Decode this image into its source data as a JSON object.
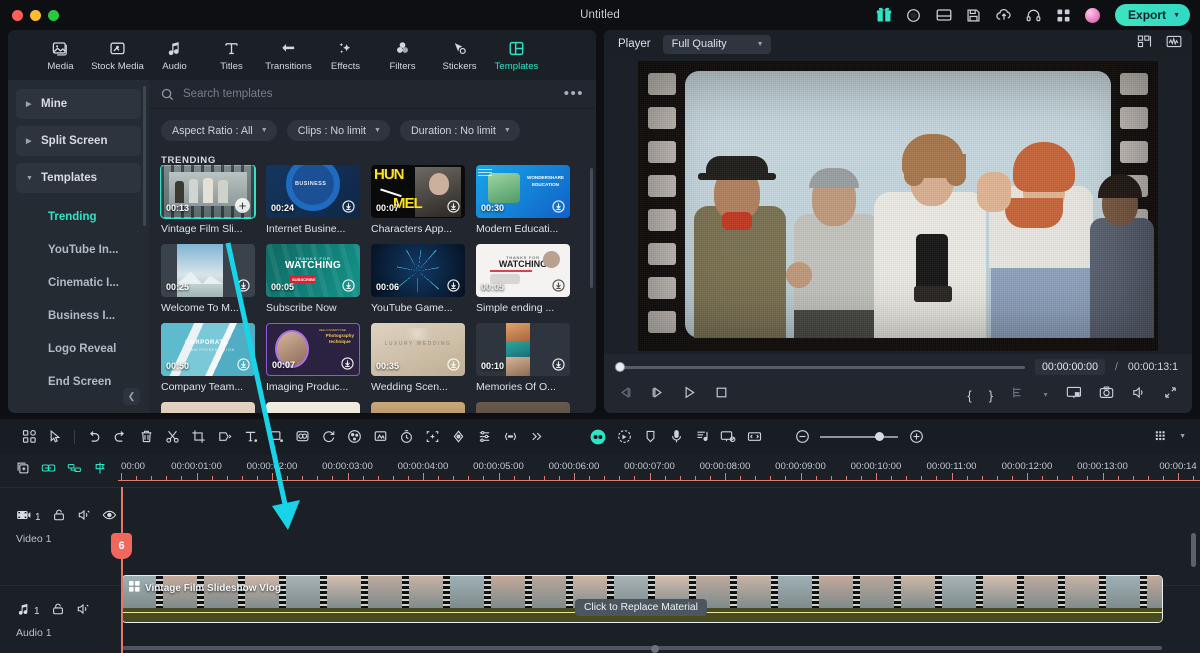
{
  "window": {
    "title": "Untitled"
  },
  "titlebar": {
    "icons": [
      "gift-icon",
      "record-icon",
      "panel-layout-icon",
      "save-icon",
      "cloud-upload-icon",
      "headset-support-icon",
      "apps-grid-icon",
      "avatar"
    ],
    "export_label": "Export"
  },
  "nav": {
    "items": [
      {
        "label": "Media",
        "icon": "media-icon",
        "active": false
      },
      {
        "label": "Stock Media",
        "icon": "stock-media-icon",
        "active": false
      },
      {
        "label": "Audio",
        "icon": "audio-note-icon",
        "active": false
      },
      {
        "label": "Titles",
        "icon": "titles-t-icon",
        "active": false
      },
      {
        "label": "Transitions",
        "icon": "transitions-arrow-icon",
        "active": false
      },
      {
        "label": "Effects",
        "icon": "effects-sparkle-icon",
        "active": false
      },
      {
        "label": "Filters",
        "icon": "filters-circles-icon",
        "active": false
      },
      {
        "label": "Stickers",
        "icon": "stickers-icon",
        "active": false
      },
      {
        "label": "Templates",
        "icon": "templates-layout-icon",
        "active": true
      }
    ]
  },
  "sidebar": {
    "groups": [
      {
        "label": "Mine",
        "expanded": false
      },
      {
        "label": "Split Screen",
        "expanded": false
      },
      {
        "label": "Templates",
        "expanded": true
      }
    ],
    "sub_items": [
      {
        "label": "Trending",
        "selected": true
      },
      {
        "label": "YouTube In...",
        "selected": false
      },
      {
        "label": "Cinematic I...",
        "selected": false
      },
      {
        "label": "Business I...",
        "selected": false
      },
      {
        "label": "Logo Reveal",
        "selected": false
      },
      {
        "label": "End Screen",
        "selected": false
      }
    ],
    "collapse_icon": "chevron-left-icon"
  },
  "search": {
    "placeholder": "Search templates",
    "value": "",
    "icon": "search-icon",
    "more_icon": "more-dots-icon"
  },
  "filters": [
    {
      "label": "Aspect Ratio : All"
    },
    {
      "label": "Clips : No limit"
    },
    {
      "label": "Duration : No limit"
    }
  ],
  "section": {
    "title": "TRENDING"
  },
  "templates": [
    {
      "name": "Vintage Film Sli...",
      "duration": "00:13",
      "selected": true,
      "action": "add"
    },
    {
      "name": "Internet Busine...",
      "duration": "00:24",
      "selected": false,
      "action": "download"
    },
    {
      "name": "Characters App...",
      "duration": "00:07",
      "selected": false,
      "action": "download"
    },
    {
      "name": "Modern Educati...",
      "duration": "00:30",
      "selected": false,
      "action": "download"
    },
    {
      "name": "Welcome To M...",
      "duration": "00:25",
      "selected": false,
      "action": "download"
    },
    {
      "name": "Subscribe Now",
      "duration": "00:05",
      "selected": false,
      "action": "download"
    },
    {
      "name": "YouTube Game...",
      "duration": "00:06",
      "selected": false,
      "action": "download"
    },
    {
      "name": "Simple ending ...",
      "duration": "00:05",
      "selected": false,
      "action": "download"
    },
    {
      "name": "Company Team...",
      "duration": "00:50",
      "selected": false,
      "action": "download"
    },
    {
      "name": "Imaging Produc...",
      "duration": "00:07",
      "selected": false,
      "action": "download"
    },
    {
      "name": "Wedding Scen...",
      "duration": "00:35",
      "selected": false,
      "action": "download"
    },
    {
      "name": "Memories Of O...",
      "duration": "00:10",
      "selected": false,
      "action": "download"
    }
  ],
  "player": {
    "label": "Player",
    "quality": "Full Quality",
    "current_time": "00:00:00:00",
    "separator": "/",
    "total_time": "00:00:13:1",
    "right_icons": [
      "grid-view-icon",
      "waveform-icon"
    ],
    "transport": [
      "prev-frame-icon",
      "next-frame-icon",
      "play-icon",
      "stop-icon"
    ],
    "tools": [
      "mark-in-brace",
      "mark-out-brace",
      "split-icon",
      "chevron-down-icon",
      "pip-screen-icon",
      "snapshot-camera-icon",
      "volume-icon",
      "fullscreen-icon"
    ],
    "mark_in": "{",
    "mark_out": "}"
  },
  "toolbar": {
    "left_icons": [
      "grid-apps-icon",
      "pointer-select-icon",
      "undo-icon",
      "redo-icon",
      "delete-trash-icon",
      "split-scissors-icon",
      "crop-icon",
      "speed-icon",
      "text-title-icon",
      "shape-icon",
      "mask-icon",
      "rotate-icon",
      "color-palette-icon",
      "stabilize-icon",
      "timer-icon",
      "motion-tracking-icon",
      "keyframe-icon",
      "adjust-sliders-icon",
      "markers-icon",
      "more-chevrons-icon"
    ],
    "right_icons": [
      "ai-copilot-icon",
      "auto-reframe-icon",
      "silence-detect-icon",
      "voice-record-icon",
      "audio-text-icon",
      "screen-record-icon",
      "fit-timeline-icon"
    ],
    "zoom_out": "−",
    "zoom_in": "+",
    "zoom_value": 70,
    "track_manager_icon": "track-manager-icon",
    "track_manager_caret": "chevron-down-icon"
  },
  "timeline": {
    "head_icons": [
      "duplicate-icon",
      "link-icon",
      "group-icon",
      "marker-icon"
    ],
    "ruler_labels": [
      "00:00",
      "00:00:01:00",
      "00:00:02:00",
      "00:00:03:00",
      "00:00:04:00",
      "00:00:05:00",
      "00:00:06:00",
      "00:00:07:00",
      "00:00:08:00",
      "00:00:09:00",
      "00:00:10:00",
      "00:00:11:00",
      "00:00:12:00",
      "00:00:13:00",
      "00:00:14"
    ],
    "playhead_label": "6",
    "tracks": [
      {
        "type": "video",
        "label": "Video 1",
        "number": "1",
        "icons": [
          "video-track-icon",
          "lock-icon",
          "mute-icon",
          "eye-visible-icon"
        ]
      },
      {
        "type": "audio",
        "label": "Audio 1",
        "number": "1",
        "icons": [
          "audio-track-icon",
          "lock-icon",
          "mute-icon"
        ]
      }
    ],
    "clip": {
      "title": "Vintage Film Slideshow Vlog",
      "icon": "template-clip-icon"
    },
    "tooltip": "Click to Replace Material"
  },
  "colors": {
    "accent": "#2fe3c7",
    "export_gradient_start": "#3fe3c0",
    "playhead": "#e8756b",
    "annotation_arrow": "#18d4e8",
    "panel_bg": "#22272f",
    "app_bg": "#0d0f13"
  }
}
